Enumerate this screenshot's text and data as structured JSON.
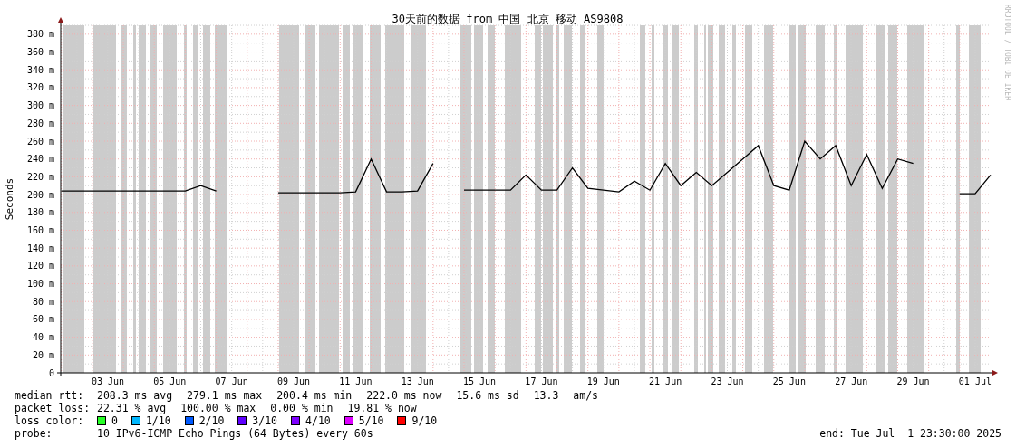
{
  "chart": {
    "watermark": "RRDTOOL / TOBI OETIKER",
    "chart_data": {
      "type": "line",
      "title": "30天前的数据 from 中国 北京 移动 AS9808",
      "ylabel": "Seconds",
      "categories": [
        null,
        null,
        null,
        "03 Jun",
        null,
        null,
        null,
        "05 Jun",
        null,
        null,
        null,
        "07 Jun",
        null,
        null,
        null,
        "09 Jun",
        null,
        null,
        null,
        "11 Jun",
        null,
        null,
        null,
        "13 Jun",
        null,
        null,
        null,
        "15 Jun",
        null,
        null,
        null,
        "17 Jun",
        null,
        null,
        null,
        "19 Jun",
        null,
        null,
        null,
        "21 Jun",
        null,
        null,
        null,
        "23 Jun",
        null,
        null,
        null,
        "25 Jun",
        null,
        null,
        null,
        "27 Jun",
        null,
        null,
        null,
        "29 Jun",
        null,
        null,
        null,
        "01 Jul",
        null
      ],
      "grid": true,
      "series": [
        {
          "color": "#000000",
          "values": [
            204,
            204,
            204,
            204,
            204,
            204,
            204,
            204,
            204,
            210,
            204,
            null,
            null,
            null,
            202,
            202,
            202,
            202,
            202,
            203,
            240,
            203,
            203,
            204,
            235,
            null,
            205,
            205,
            205,
            205,
            222,
            205,
            205,
            230,
            207,
            205,
            203,
            215,
            205,
            235,
            210,
            225,
            210,
            225,
            240,
            255,
            210,
            205,
            260,
            240,
            255,
            210,
            245,
            207,
            240,
            235,
            null,
            null,
            201,
            201,
            222
          ]
        }
      ],
      "ylim": [
        0,
        390
      ],
      "yticks": [
        {
          "value": 0,
          "label": "0"
        },
        {
          "value": 20,
          "label": "20 m"
        },
        {
          "value": 40,
          "label": "40 m"
        },
        {
          "value": 60,
          "label": "60 m"
        },
        {
          "value": 80,
          "label": "80 m"
        },
        {
          "value": 100,
          "label": "100 m"
        },
        {
          "value": 120,
          "label": "120 m"
        },
        {
          "value": 140,
          "label": "140 m"
        },
        {
          "value": 160,
          "label": "160 m"
        },
        {
          "value": 180,
          "label": "180 m"
        },
        {
          "value": 200,
          "label": "200 m"
        },
        {
          "value": 220,
          "label": "220 m"
        },
        {
          "value": 240,
          "label": "240 m"
        },
        {
          "value": 260,
          "label": "260 m"
        },
        {
          "value": 280,
          "label": "280 m"
        },
        {
          "value": 300,
          "label": "300 m"
        },
        {
          "value": 320,
          "label": "320 m"
        },
        {
          "value": 340,
          "label": "340 m"
        },
        {
          "value": 360,
          "label": "360 m"
        },
        {
          "value": 380,
          "label": "380 m"
        }
      ]
    }
  },
  "legend": {
    "median_rtt": {
      "label": "median rtt:",
      "values": [
        "208.3 ms avg",
        "279.1 ms max",
        "200.4 ms min",
        "222.0 ms now",
        "15.6 ms sd",
        "13.3",
        "am/s"
      ]
    },
    "packet_loss": {
      "label": "packet loss:",
      "values": [
        "22.31 % avg",
        "100.00 % max",
        "0.00 % min",
        "19.81 % now"
      ]
    },
    "loss_color": {
      "label": "loss color:",
      "items": [
        {
          "label": "0",
          "color": "#26ff26"
        },
        {
          "label": "1/10",
          "color": "#00b8ff"
        },
        {
          "label": "2/10",
          "color": "#0059ff"
        },
        {
          "label": "3/10",
          "color": "#5e00ff"
        },
        {
          "label": "4/10",
          "color": "#7e00ff"
        },
        {
          "label": "5/10",
          "color": "#dd00ff"
        },
        {
          "label": "9/10",
          "color": "#ff0000"
        }
      ]
    },
    "probe": {
      "label": "probe:",
      "value": "10 IPv6-ICMP Echo Pings (64 Bytes) every 60s",
      "end": "end: Tue Jul  1 23:30:00 2025"
    }
  }
}
